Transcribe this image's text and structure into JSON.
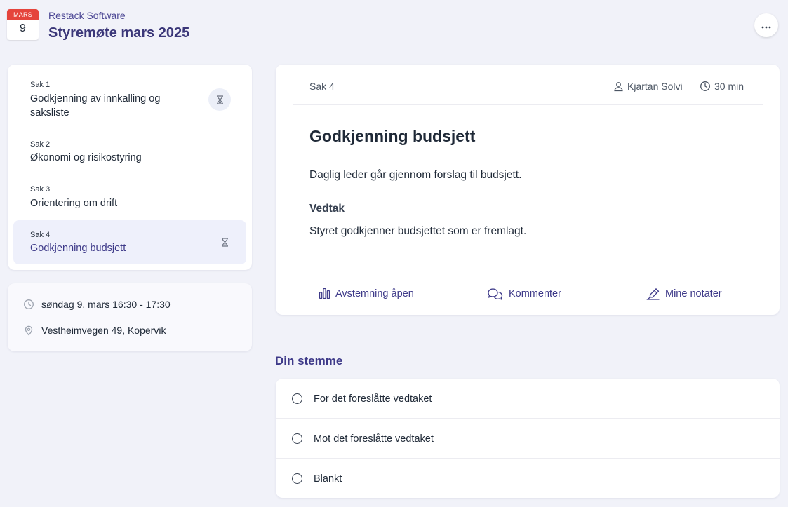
{
  "header": {
    "calendar_month": "MARS",
    "calendar_day": "9",
    "organization": "Restack Software",
    "title": "Styremøte mars 2025",
    "more_icon": "ellipsis-icon"
  },
  "agenda": {
    "items": [
      {
        "number": "Sak 1",
        "label": "Godkjenning av innkalling og saksliste",
        "status_icon": "hourglass-icon"
      },
      {
        "number": "Sak 2",
        "label": "Økonomi og risikostyring"
      },
      {
        "number": "Sak 3",
        "label": "Orientering om drift"
      },
      {
        "number": "Sak 4",
        "label": "Godkjenning budsjett",
        "status_icon": "hourglass-icon",
        "active": true
      }
    ]
  },
  "meeting_info": {
    "time": "søndag 9. mars 16:30 - 17:30",
    "location": "Vestheimvegen 49, Kopervik"
  },
  "item_detail": {
    "sak_label": "Sak 4",
    "presenter": "Kjartan Solvi",
    "duration": "30 min",
    "title": "Godkjenning budsjett",
    "description": "Daglig leder går gjennom forslag til budsjett.",
    "decision_heading": "Vedtak",
    "decision_text": "Styret godkjenner budsjettet som er fremlagt.",
    "actions": {
      "vote": "Avstemning åpen",
      "comment": "Kommenter",
      "notes": "Mine notater"
    }
  },
  "vote": {
    "heading": "Din stemme",
    "options": [
      "For det foreslåtte vedtaket",
      "Mot det foreslåtte vedtaket",
      "Blankt"
    ]
  },
  "colors": {
    "accent": "#3e3a89",
    "calendar_red": "#e5443c",
    "background": "#f1f2f9"
  }
}
